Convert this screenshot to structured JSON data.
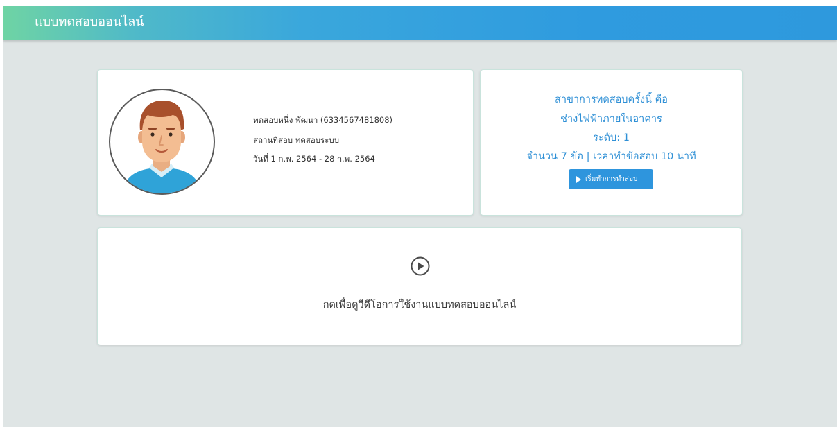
{
  "header": {
    "title": "แบบทดสอบออนไลน์"
  },
  "profile": {
    "avatar_icon": "male-avatar-icon",
    "name_line": "ทดสอบหนึ่ง พัฒนา (6334567481808)",
    "location_line": "สถานที่สอบ ทดสอบระบบ",
    "date_line": "วันที่ 1 ก.พ. 2564 - 28 ก.พ. 2564"
  },
  "exam": {
    "line1": "สาขาการทดสอบครั้งนี้ คือ",
    "line2": "ช่างไฟฟ้าภายในอาคาร",
    "line3": "ระดับ: 1",
    "line4": "จำนวน 7 ข้อ | เวลาทำข้อสอบ 10 นาที",
    "start_button_label": "เริ่มทำการทำสอบ",
    "start_button_icon": "play-icon",
    "accent_color": "#2f90d6"
  },
  "video": {
    "icon": "play-circle-icon",
    "label": "กดเพื่อดูวีดีโอการใช้งานแบบทดสอบออนไลน์"
  }
}
